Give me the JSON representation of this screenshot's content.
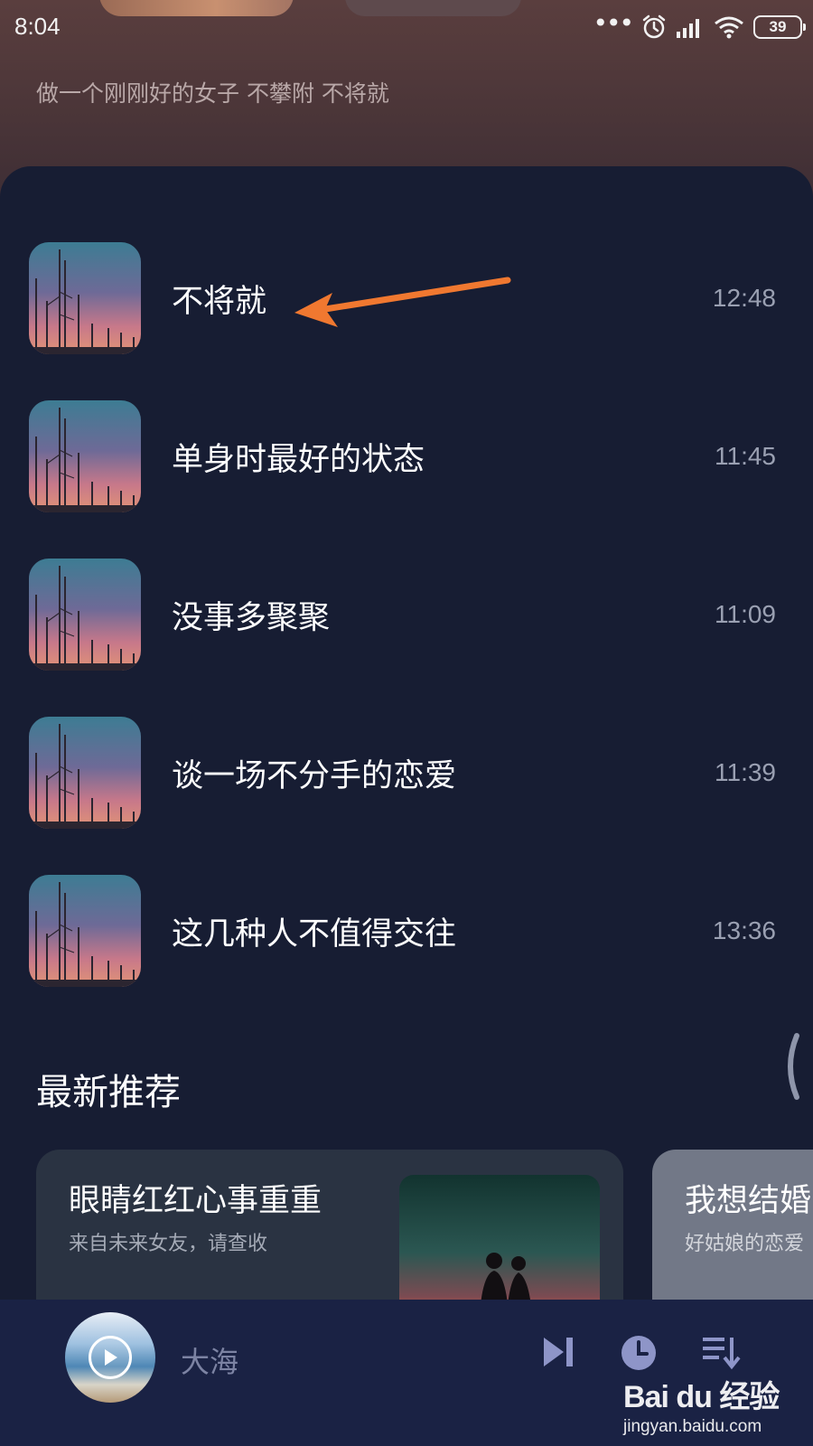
{
  "status_bar": {
    "time": "8:04",
    "dots": "•••",
    "battery": "39"
  },
  "header": {
    "subtitle": "做一个刚刚好的女子 不攀附 不将就"
  },
  "playlist": {
    "items": [
      {
        "title": "不将就",
        "duration": "12:48"
      },
      {
        "title": "单身时最好的状态",
        "duration": "11:45"
      },
      {
        "title": "没事多聚聚",
        "duration": "11:09"
      },
      {
        "title": "谈一场不分手的恋爱",
        "duration": "11:39"
      },
      {
        "title": "这几种人不值得交往",
        "duration": "13:36"
      }
    ]
  },
  "recommend": {
    "section_title": "最新推荐",
    "cards": [
      {
        "title": "眼睛红红心事重重",
        "subtitle": "来自未来女友，请查收"
      },
      {
        "title": "我想结婚",
        "subtitle": "好姑娘的恋爱"
      }
    ]
  },
  "player": {
    "track": "大海"
  },
  "watermark": {
    "logo": "Bai du 经验",
    "url": "jingyan.baidu.com"
  },
  "colors": {
    "background": "#171d33",
    "player_bar": "#1a2244",
    "annotation_arrow": "#f07830",
    "duration_text": "#9aa0b2"
  }
}
